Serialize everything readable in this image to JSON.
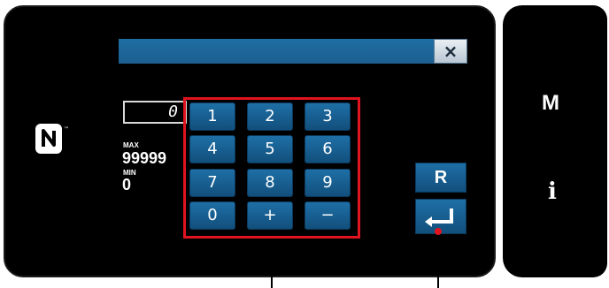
{
  "dialog": {
    "close_label": "×"
  },
  "input": {
    "value": "0",
    "max_label": "MAX",
    "max_value": "99999",
    "min_label": "MIN",
    "min_value": "0"
  },
  "keypad": {
    "keys": [
      "1",
      "2",
      "3",
      "4",
      "5",
      "6",
      "7",
      "8",
      "9",
      "0",
      "+",
      "−"
    ]
  },
  "buttons": {
    "reset_label": "R"
  },
  "side_panel": {
    "mode_label": "M",
    "info_label": "i"
  },
  "colors": {
    "panel_bg": "#000000",
    "button_blue": "#1e6fa6",
    "highlight_red": "#e0141f"
  },
  "icons": [
    "nfc-icon",
    "close-icon",
    "enter-icon"
  ]
}
